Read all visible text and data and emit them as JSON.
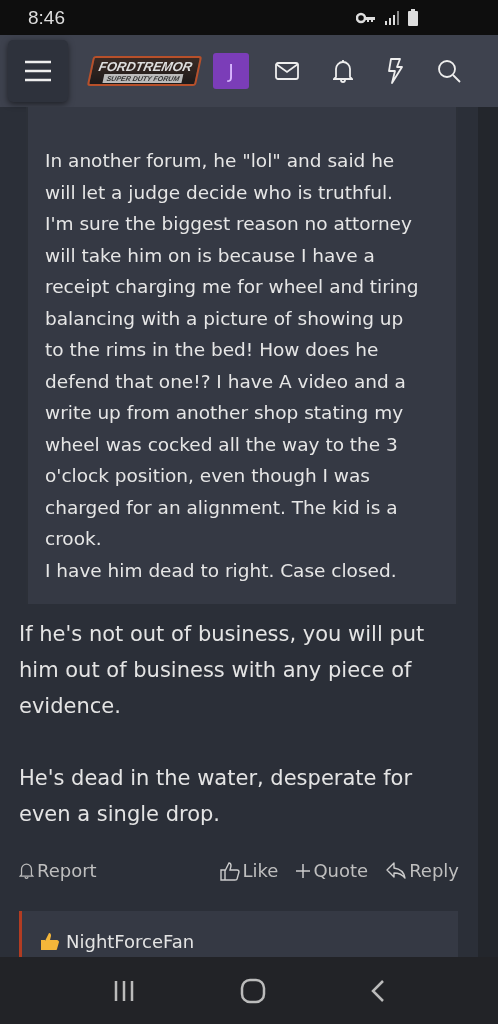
{
  "status_bar": {
    "time": "8:46"
  },
  "header": {
    "logo": {
      "title": "FORDTREMOR",
      "subtitle": "SUPER DUTY FORUM"
    },
    "avatar": "J"
  },
  "quote": {
    "paragraphs": [
      "In another forum, he \"lol\" and said he will let a judge decide who is truthful. I'm sure the biggest reason no attorney will take him on is because I have a receipt charging me for wheel and tiring balancing with a picture of showing up to the rims in the bed! How does he defend that one!? I have A video and a write up from another shop stating my wheel was cocked all the way to the 3 o'clock position, even though I was charged for an alignment. The kid is a crook.",
      "I have him dead to right. Case closed."
    ]
  },
  "post": {
    "paragraphs": [
      "If he's not out of business, you will put him out of business with any piece of evidence.",
      "He's dead in the water, desperate for even a single drop."
    ]
  },
  "actions": [
    {
      "kind": "report",
      "label": "Report"
    },
    {
      "kind": "like",
      "label": "Like"
    },
    {
      "kind": "quote",
      "label": "Quote"
    },
    {
      "kind": "reply",
      "label": "Reply"
    }
  ],
  "reaction": {
    "user": "NightForceFan"
  }
}
